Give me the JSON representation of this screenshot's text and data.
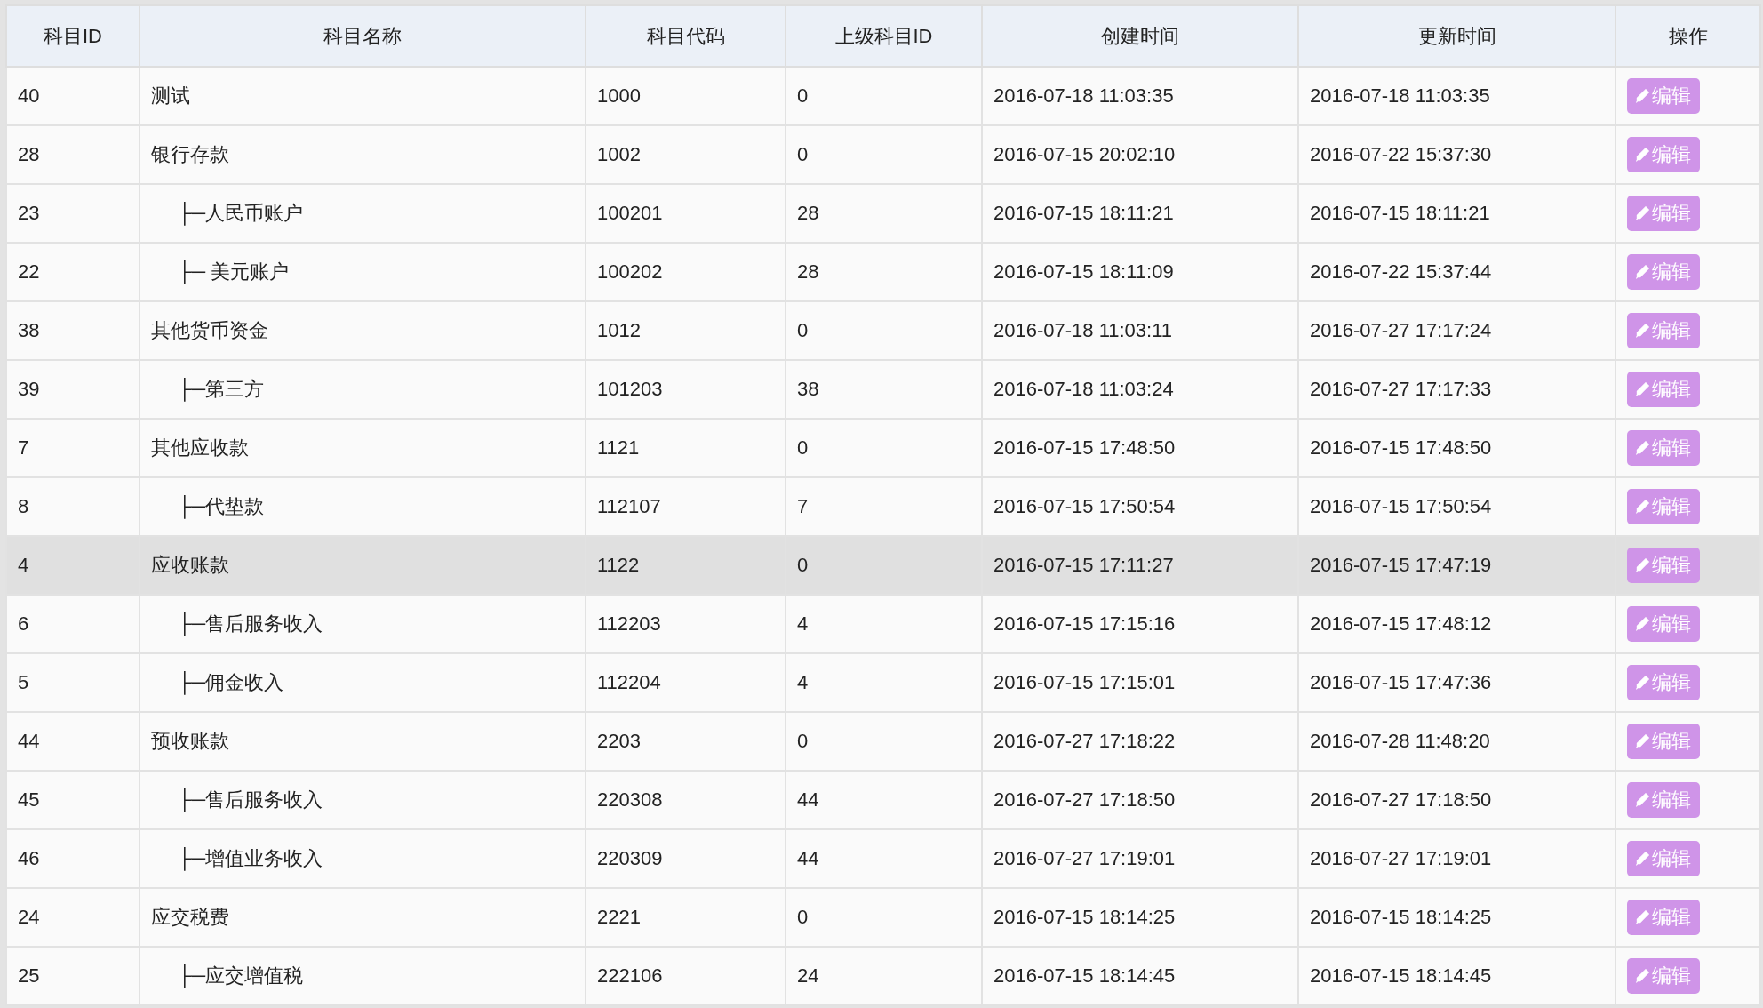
{
  "table": {
    "columns": [
      "科目ID",
      "科目名称",
      "科目代码",
      "上级科目ID",
      "创建时间",
      "更新时间",
      "操作"
    ],
    "rows": [
      {
        "id": "40",
        "name": "测试",
        "code": "1000",
        "parent_id": "0",
        "created": "2016-07-18 11:03:35",
        "updated": "2016-07-18 11:03:35",
        "action": "编辑",
        "selected": false
      },
      {
        "id": "28",
        "name": "银行存款",
        "code": "1002",
        "parent_id": "0",
        "created": "2016-07-15 20:02:10",
        "updated": "2016-07-22 15:37:30",
        "action": "编辑",
        "selected": false,
        "children": [
          {
            "id": "23",
            "name": "├─人民币账户",
            "code": "100201",
            "parent_id": "28",
            "created": "2016-07-15 18:11:21",
            "updated": "2016-07-15 18:11:21",
            "action": "编辑",
            "selected": false
          },
          {
            "id": "22",
            "name": "├─ 美元账户",
            "code": "100202",
            "parent_id": "28",
            "created": "2016-07-15 18:11:09",
            "updated": "2016-07-22 15:37:44",
            "action": "编辑",
            "selected": false
          }
        ]
      },
      {
        "id": "38",
        "name": "其他货币资金",
        "code": "1012",
        "parent_id": "0",
        "created": "2016-07-18 11:03:11",
        "updated": "2016-07-27 17:17:24",
        "action": "编辑",
        "selected": false,
        "children": [
          {
            "id": "39",
            "name": "├─第三方",
            "code": "101203",
            "parent_id": "38",
            "created": "2016-07-18 11:03:24",
            "updated": "2016-07-27 17:17:33",
            "action": "编辑",
            "selected": false
          }
        ]
      },
      {
        "id": "7",
        "name": "其他应收款",
        "code": "1121",
        "parent_id": "0",
        "created": "2016-07-15 17:48:50",
        "updated": "2016-07-15 17:48:50",
        "action": "编辑",
        "selected": false,
        "children": [
          {
            "id": "8",
            "name": "├─代垫款",
            "code": "112107",
            "parent_id": "7",
            "created": "2016-07-15 17:50:54",
            "updated": "2016-07-15 17:50:54",
            "action": "编辑",
            "selected": false
          }
        ]
      },
      {
        "id": "4",
        "name": "应收账款",
        "code": "1122",
        "parent_id": "0",
        "created": "2016-07-15 17:11:27",
        "updated": "2016-07-15 17:47:19",
        "action": "编辑",
        "selected": true,
        "children": [
          {
            "id": "6",
            "name": "├─售后服务收入",
            "code": "112203",
            "parent_id": "4",
            "created": "2016-07-15 17:15:16",
            "updated": "2016-07-15 17:48:12",
            "action": "编辑",
            "selected": false
          },
          {
            "id": "5",
            "name": "├─佣金收入",
            "code": "112204",
            "parent_id": "4",
            "created": "2016-07-15 17:15:01",
            "updated": "2016-07-15 17:47:36",
            "action": "编辑",
            "selected": false
          }
        ]
      },
      {
        "id": "44",
        "name": "预收账款",
        "code": "2203",
        "parent_id": "0",
        "created": "2016-07-27 17:18:22",
        "updated": "2016-07-28 11:48:20",
        "action": "编辑",
        "selected": false,
        "children": [
          {
            "id": "45",
            "name": "├─售后服务收入",
            "code": "220308",
            "parent_id": "44",
            "created": "2016-07-27 17:18:50",
            "updated": "2016-07-27 17:18:50",
            "action": "编辑",
            "selected": false
          },
          {
            "id": "46",
            "name": "├─增值业务收入",
            "code": "220309",
            "parent_id": "44",
            "created": "2016-07-27 17:19:01",
            "updated": "2016-07-27 17:19:01",
            "action": "编辑",
            "selected": false
          }
        ]
      },
      {
        "id": "24",
        "name": "应交税费",
        "code": "2221",
        "parent_id": "0",
        "created": "2016-07-15 18:14:25",
        "updated": "2016-07-15 18:14:25",
        "action": "编辑",
        "selected": false,
        "children": [
          {
            "id": "25",
            "name": "├─应交增值税",
            "code": "222106",
            "parent_id": "24",
            "created": "2016-07-15 18:14:45",
            "updated": "2016-07-15 18:14:45",
            "action": "编辑",
            "selected": false
          }
        ]
      }
    ]
  }
}
